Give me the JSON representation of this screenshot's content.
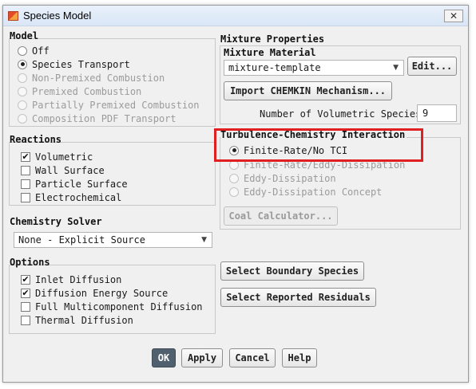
{
  "window": {
    "title": "Species Model",
    "close_label": "✕"
  },
  "model": {
    "title": "Model",
    "options": [
      {
        "label": "Off",
        "selected": false,
        "enabled": true
      },
      {
        "label": "Species Transport",
        "selected": true,
        "enabled": true
      },
      {
        "label": "Non-Premixed Combustion",
        "selected": false,
        "enabled": false
      },
      {
        "label": "Premixed Combustion",
        "selected": false,
        "enabled": false
      },
      {
        "label": "Partially Premixed Combustion",
        "selected": false,
        "enabled": false
      },
      {
        "label": "Composition PDF Transport",
        "selected": false,
        "enabled": false
      }
    ]
  },
  "reactions": {
    "title": "Reactions",
    "items": [
      {
        "label": "Volumetric",
        "checked": true
      },
      {
        "label": "Wall Surface",
        "checked": false
      },
      {
        "label": "Particle Surface",
        "checked": false
      },
      {
        "label": "Electrochemical",
        "checked": false
      }
    ]
  },
  "chemistry_solver": {
    "title": "Chemistry Solver",
    "value": "None - Explicit Source"
  },
  "options": {
    "title": "Options",
    "items": [
      {
        "label": "Inlet Diffusion",
        "checked": true
      },
      {
        "label": "Diffusion Energy Source",
        "checked": true
      },
      {
        "label": "Full Multicomponent Diffusion",
        "checked": false
      },
      {
        "label": "Thermal Diffusion",
        "checked": false
      }
    ]
  },
  "mixture": {
    "title": "Mixture Properties",
    "material_label": "Mixture Material",
    "material_value": "mixture-template",
    "edit_label": "Edit...",
    "import_label": "Import CHEMKIN Mechanism...",
    "num_species_label": "Number of Volumetric Species",
    "num_species_value": "9"
  },
  "tci": {
    "title": "Turbulence-Chemistry Interaction",
    "options": [
      {
        "label": "Finite-Rate/No TCI",
        "selected": true,
        "enabled": true
      },
      {
        "label": "Finite-Rate/Eddy-Dissipation",
        "selected": false,
        "enabled": false
      },
      {
        "label": "Eddy-Dissipation",
        "selected": false,
        "enabled": false
      },
      {
        "label": "Eddy-Dissipation Concept",
        "selected": false,
        "enabled": false
      }
    ],
    "coal_label": "Coal Calculator..."
  },
  "side_buttons": {
    "boundary_species": "Select Boundary Species",
    "reported_residuals": "Select Reported Residuals"
  },
  "footer": {
    "ok": "OK",
    "apply": "Apply",
    "cancel": "Cancel",
    "help": "Help"
  },
  "colors": {
    "highlight": "#e02020",
    "ok_button": "#51606f"
  }
}
